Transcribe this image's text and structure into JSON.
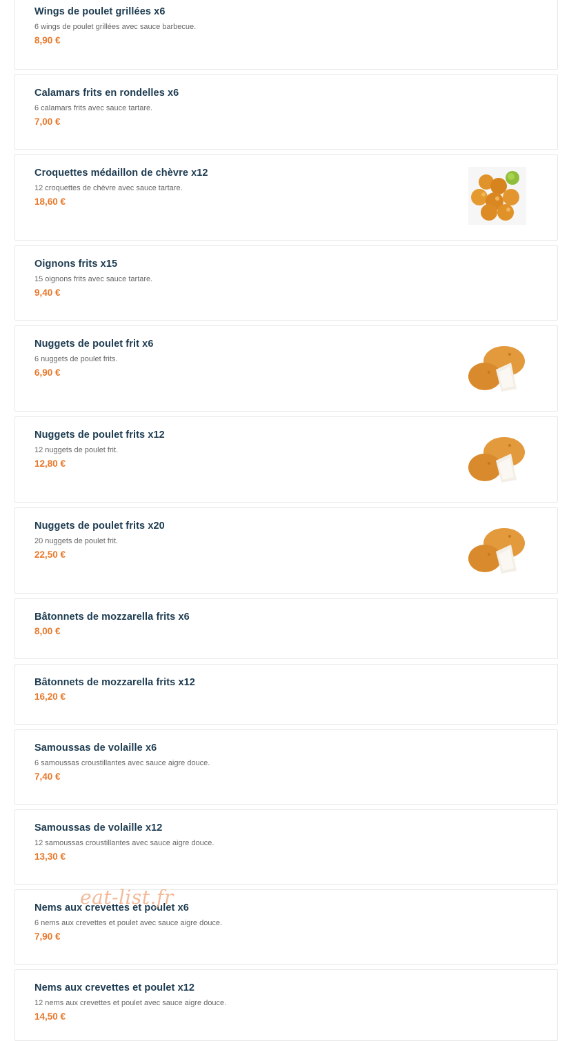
{
  "watermark": "eat-list.fr",
  "colors": {
    "title": "#1d3b50",
    "price": "#e8782a",
    "border": "#e8e8e8"
  },
  "items": [
    {
      "name": "Wings de poulet grillées x6",
      "desc": "6 wings de poulet grillées avec sauce barbecue.",
      "price": "8,90 €"
    },
    {
      "name": "Calamars frits en rondelles x6",
      "desc": "6 calamars frits avec sauce tartare.",
      "price": "7,00 €"
    },
    {
      "name": "Croquettes médaillon de chèvre x12",
      "desc": "12 croquettes de chèvre avec sauce tartare.",
      "price": "18,60 €",
      "image": "goat-cheese-croquettes-photo"
    },
    {
      "name": "Oignons frits x15",
      "desc": "15 oignons frits avec sauce tartare.",
      "price": "9,40 €"
    },
    {
      "name": "Nuggets de poulet frit x6",
      "desc": "6 nuggets de poulet frits.",
      "price": "6,90 €",
      "image": "chicken-nuggets-photo"
    },
    {
      "name": "Nuggets de poulet frits x12",
      "desc": "12 nuggets de poulet frit.",
      "price": "12,80 €",
      "image": "chicken-nuggets-photo"
    },
    {
      "name": "Nuggets de poulet frits x20",
      "desc": "20 nuggets de poulet frit.",
      "price": "22,50 €",
      "image": "chicken-nuggets-photo"
    },
    {
      "name": "Bâtonnets de mozzarella frits x6",
      "price": "8,00 €"
    },
    {
      "name": "Bâtonnets de mozzarella frits x12",
      "price": "16,20 €"
    },
    {
      "name": "Samoussas de volaille x6",
      "desc": "6 samoussas croustillantes avec sauce aigre douce.",
      "price": "7,40 €"
    },
    {
      "name": "Samoussas de volaille x12",
      "desc": "12 samoussas croustillantes avec sauce aigre douce.",
      "price": "13,30 €"
    },
    {
      "name": "Nems aux crevettes et poulet x6",
      "desc": "6 nems aux crevettes et poulet avec sauce aigre douce.",
      "price": "7,90 €"
    },
    {
      "name": "Nems aux crevettes et poulet x12",
      "desc": "12 nems aux crevettes et poulet avec sauce aigre douce.",
      "price": "14,50 €"
    }
  ]
}
